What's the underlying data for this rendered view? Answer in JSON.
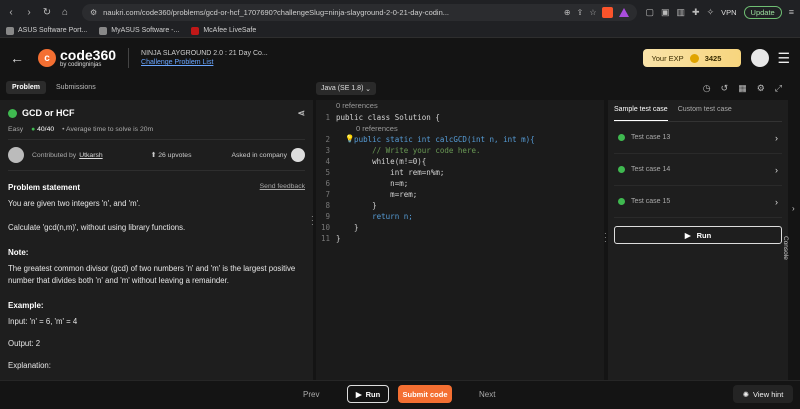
{
  "browser": {
    "url": "naukri.com/code360/problems/gcd-or-hcf_1707690?challengeSlug=ninja-slayground-2-0-21-day-codin...",
    "vpn_label": "VPN",
    "update_label": "Update"
  },
  "bookmarks": [
    "ASUS Software Port...",
    "MyASUS Software -...",
    "McAfee LiveSafe"
  ],
  "header": {
    "logo_main": "code360",
    "logo_sub": "by codingninjas",
    "challenge_title": "NINJA SLAYGROUND 2.0 : 21 Day Co...",
    "challenge_link": "Challenge Problem List",
    "exp_label": "Your EXP",
    "exp_value": "3425"
  },
  "tabs": [
    "Problem",
    "Submissions"
  ],
  "language": "Java (SE 1.8)",
  "problem": {
    "title": "GCD or HCF",
    "difficulty": "Easy",
    "points": "40/40",
    "avg_time": "Average time to solve is 20m",
    "contributed_by": "Contributed by",
    "contributor": "Utkarsh",
    "upvotes": "26 upvotes",
    "asked_in": "Asked in company",
    "statement_title": "Problem statement",
    "send_feedback": "Send feedback",
    "para1": "You are given two integers 'n', and 'm'.",
    "para2": "Calculate 'gcd(n,m)', without using library functions.",
    "note_title": "Note:",
    "note_text": "The greatest common divisor (gcd) of two numbers 'n' and 'm' is the largest positive number that divides both 'n' and 'm' without leaving a remainder.",
    "example_title": "Example:",
    "input": "Input: 'n' = 6, 'm' = 4",
    "output": "Output: 2",
    "explanation": "Explanation:"
  },
  "editor": {
    "ref0": "0 references",
    "ref1": "0 references",
    "lines": [
      "public class Solution {",
      "    public static int calcGCD(int n, int m){",
      "        // Write your code here.",
      "        while(m!=0){",
      "            int rem=n%m;",
      "            n=m;",
      "            m=rem;",
      "        }",
      "        return n;",
      "    }",
      "}"
    ]
  },
  "right": {
    "tabs": [
      "Sample test case",
      "Custom test case"
    ],
    "tests": [
      "Test case 13",
      "Test case 14",
      "Test case 15"
    ],
    "run_label": "Run",
    "console_label": "Console"
  },
  "bottom": {
    "prev": "Prev",
    "run": "Run",
    "submit": "Submit code",
    "next": "Next",
    "hint": "View hint"
  },
  "colors": {
    "accent": "#f46f32",
    "success": "#3fb950",
    "link": "#6aa6ff"
  }
}
